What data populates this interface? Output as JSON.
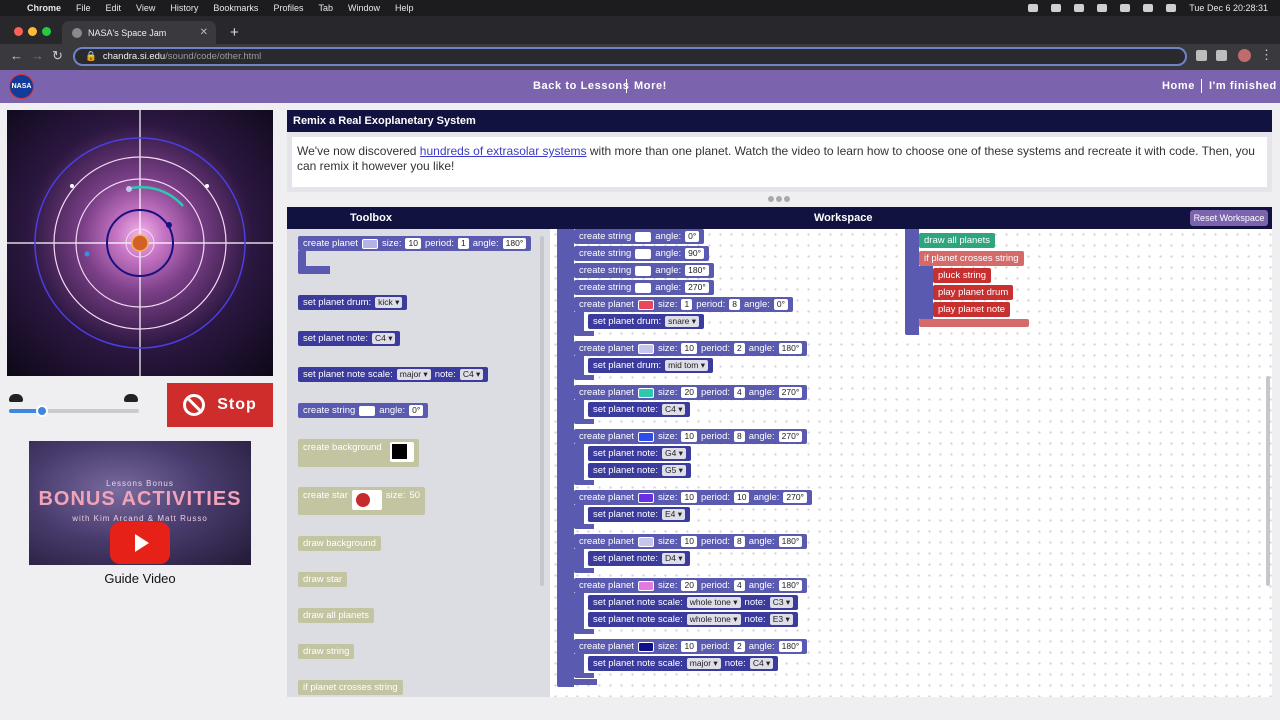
{
  "macos": {
    "app": "Chrome",
    "menus": [
      "File",
      "Edit",
      "View",
      "History",
      "Bookmarks",
      "Profiles",
      "Tab",
      "Window",
      "Help"
    ],
    "datetime": "Tue Dec 6  20:28:31"
  },
  "browser": {
    "tab_title": "NASA's Space Jam",
    "url_domain": "chandra.si.edu",
    "url_path": "/sound/code/other.html"
  },
  "site_nav": {
    "logo": "NASA",
    "back_to_lessons": "Back to Lessons",
    "more": "More!",
    "home": "Home",
    "finished": "I'm finished"
  },
  "left": {
    "stop_label": "Stop",
    "video": {
      "small_text": "Lessons Bonus",
      "title": "BONUS ACTIVITIES",
      "subtitle": "with Kim Arcand & Matt Russo"
    },
    "guide_label": "Guide Video",
    "slow_icon": "turtle-icon",
    "fast_icon": "rabbit-icon",
    "speed_level": 0.25
  },
  "lesson": {
    "title": "Remix a Real Exoplanetary System",
    "text_before": "We've now discovered ",
    "link": "hundreds of extrasolar systems",
    "text_after": " with more than one planet. Watch the video to learn how to choose one of these systems and recreate it with code. Then, you can remix it however you like!"
  },
  "editor": {
    "toolbox_label": "Toolbox",
    "workspace_label": "Workspace",
    "reset_label": "Reset Workspace"
  },
  "toolbox": [
    {
      "label": "create planet",
      "color": "#b3b3e6",
      "size": "10",
      "period": "1",
      "angle": "180°"
    },
    {
      "label": "set planet drum:",
      "value": "kick"
    },
    {
      "label": "set planet note:",
      "value": "C4"
    },
    {
      "label": "set planet note  scale:",
      "scale": "major",
      "note_label": "note:",
      "note": "C4"
    },
    {
      "label": "create string",
      "color": "#ffffff",
      "angle": "0°"
    },
    {
      "label": "create background",
      "color": "#000000"
    },
    {
      "label": "create star",
      "size": "50"
    },
    {
      "label": "draw background"
    },
    {
      "label": "draw star"
    },
    {
      "label": "draw all planets"
    },
    {
      "label": "draw string"
    },
    {
      "label": "if planet crosses string"
    }
  ],
  "workspace_strings": [
    {
      "label": "create string",
      "angle": "0°"
    },
    {
      "label": "create string",
      "angle": "90°"
    },
    {
      "label": "create string",
      "angle": "180°"
    },
    {
      "label": "create string",
      "angle": "270°"
    }
  ],
  "workspace_planets": [
    {
      "color": "#e8485a",
      "size": "1",
      "period": "8",
      "angle": "0°",
      "children": [
        {
          "label": "set planet drum:",
          "value": "snare"
        }
      ]
    },
    {
      "color": "#c5c5ee",
      "size": "10",
      "period": "2",
      "angle": "180°",
      "children": [
        {
          "label": "set planet drum:",
          "value": "mid tom"
        }
      ]
    },
    {
      "color": "#2ec8b0",
      "size": "20",
      "period": "4",
      "angle": "270°",
      "children": [
        {
          "label": "set planet note:",
          "value": "C4"
        }
      ]
    },
    {
      "color": "#2f4de8",
      "size": "10",
      "period": "8",
      "angle": "270°",
      "children": [
        {
          "label": "set planet note:",
          "value": "G4"
        },
        {
          "label": "set planet note:",
          "value": "G5"
        }
      ]
    },
    {
      "color": "#6a2fe0",
      "size": "10",
      "period": "10",
      "angle": "270°",
      "children": [
        {
          "label": "set planet note:",
          "value": "E4"
        }
      ]
    },
    {
      "color": "#c5c5ee",
      "size": "10",
      "period": "8",
      "angle": "180°",
      "children": [
        {
          "label": "set planet note:",
          "value": "D4"
        }
      ]
    },
    {
      "color": "#e27ae0",
      "size": "20",
      "period": "4",
      "angle": "180°",
      "children": [
        {
          "label": "set planet note  scale:",
          "scale": "whole tone",
          "note": "C3"
        },
        {
          "label": "set planet note  scale:",
          "scale": "whole tone",
          "note": "E3"
        }
      ]
    },
    {
      "color": "#10108a",
      "size": "10",
      "period": "2",
      "angle": "180°",
      "children": [
        {
          "label": "set planet note  scale:",
          "scale": "major",
          "note": "C4"
        }
      ]
    }
  ],
  "workspace_loop": {
    "draw_all": "draw all planets",
    "if_label": "if planet crosses string",
    "actions": [
      "pluck string",
      "play planet drum",
      "play planet note"
    ]
  },
  "block_words": {
    "create_planet": "create planet",
    "size": "size:",
    "period": "period:",
    "angle": "angle:",
    "note": "note:"
  }
}
